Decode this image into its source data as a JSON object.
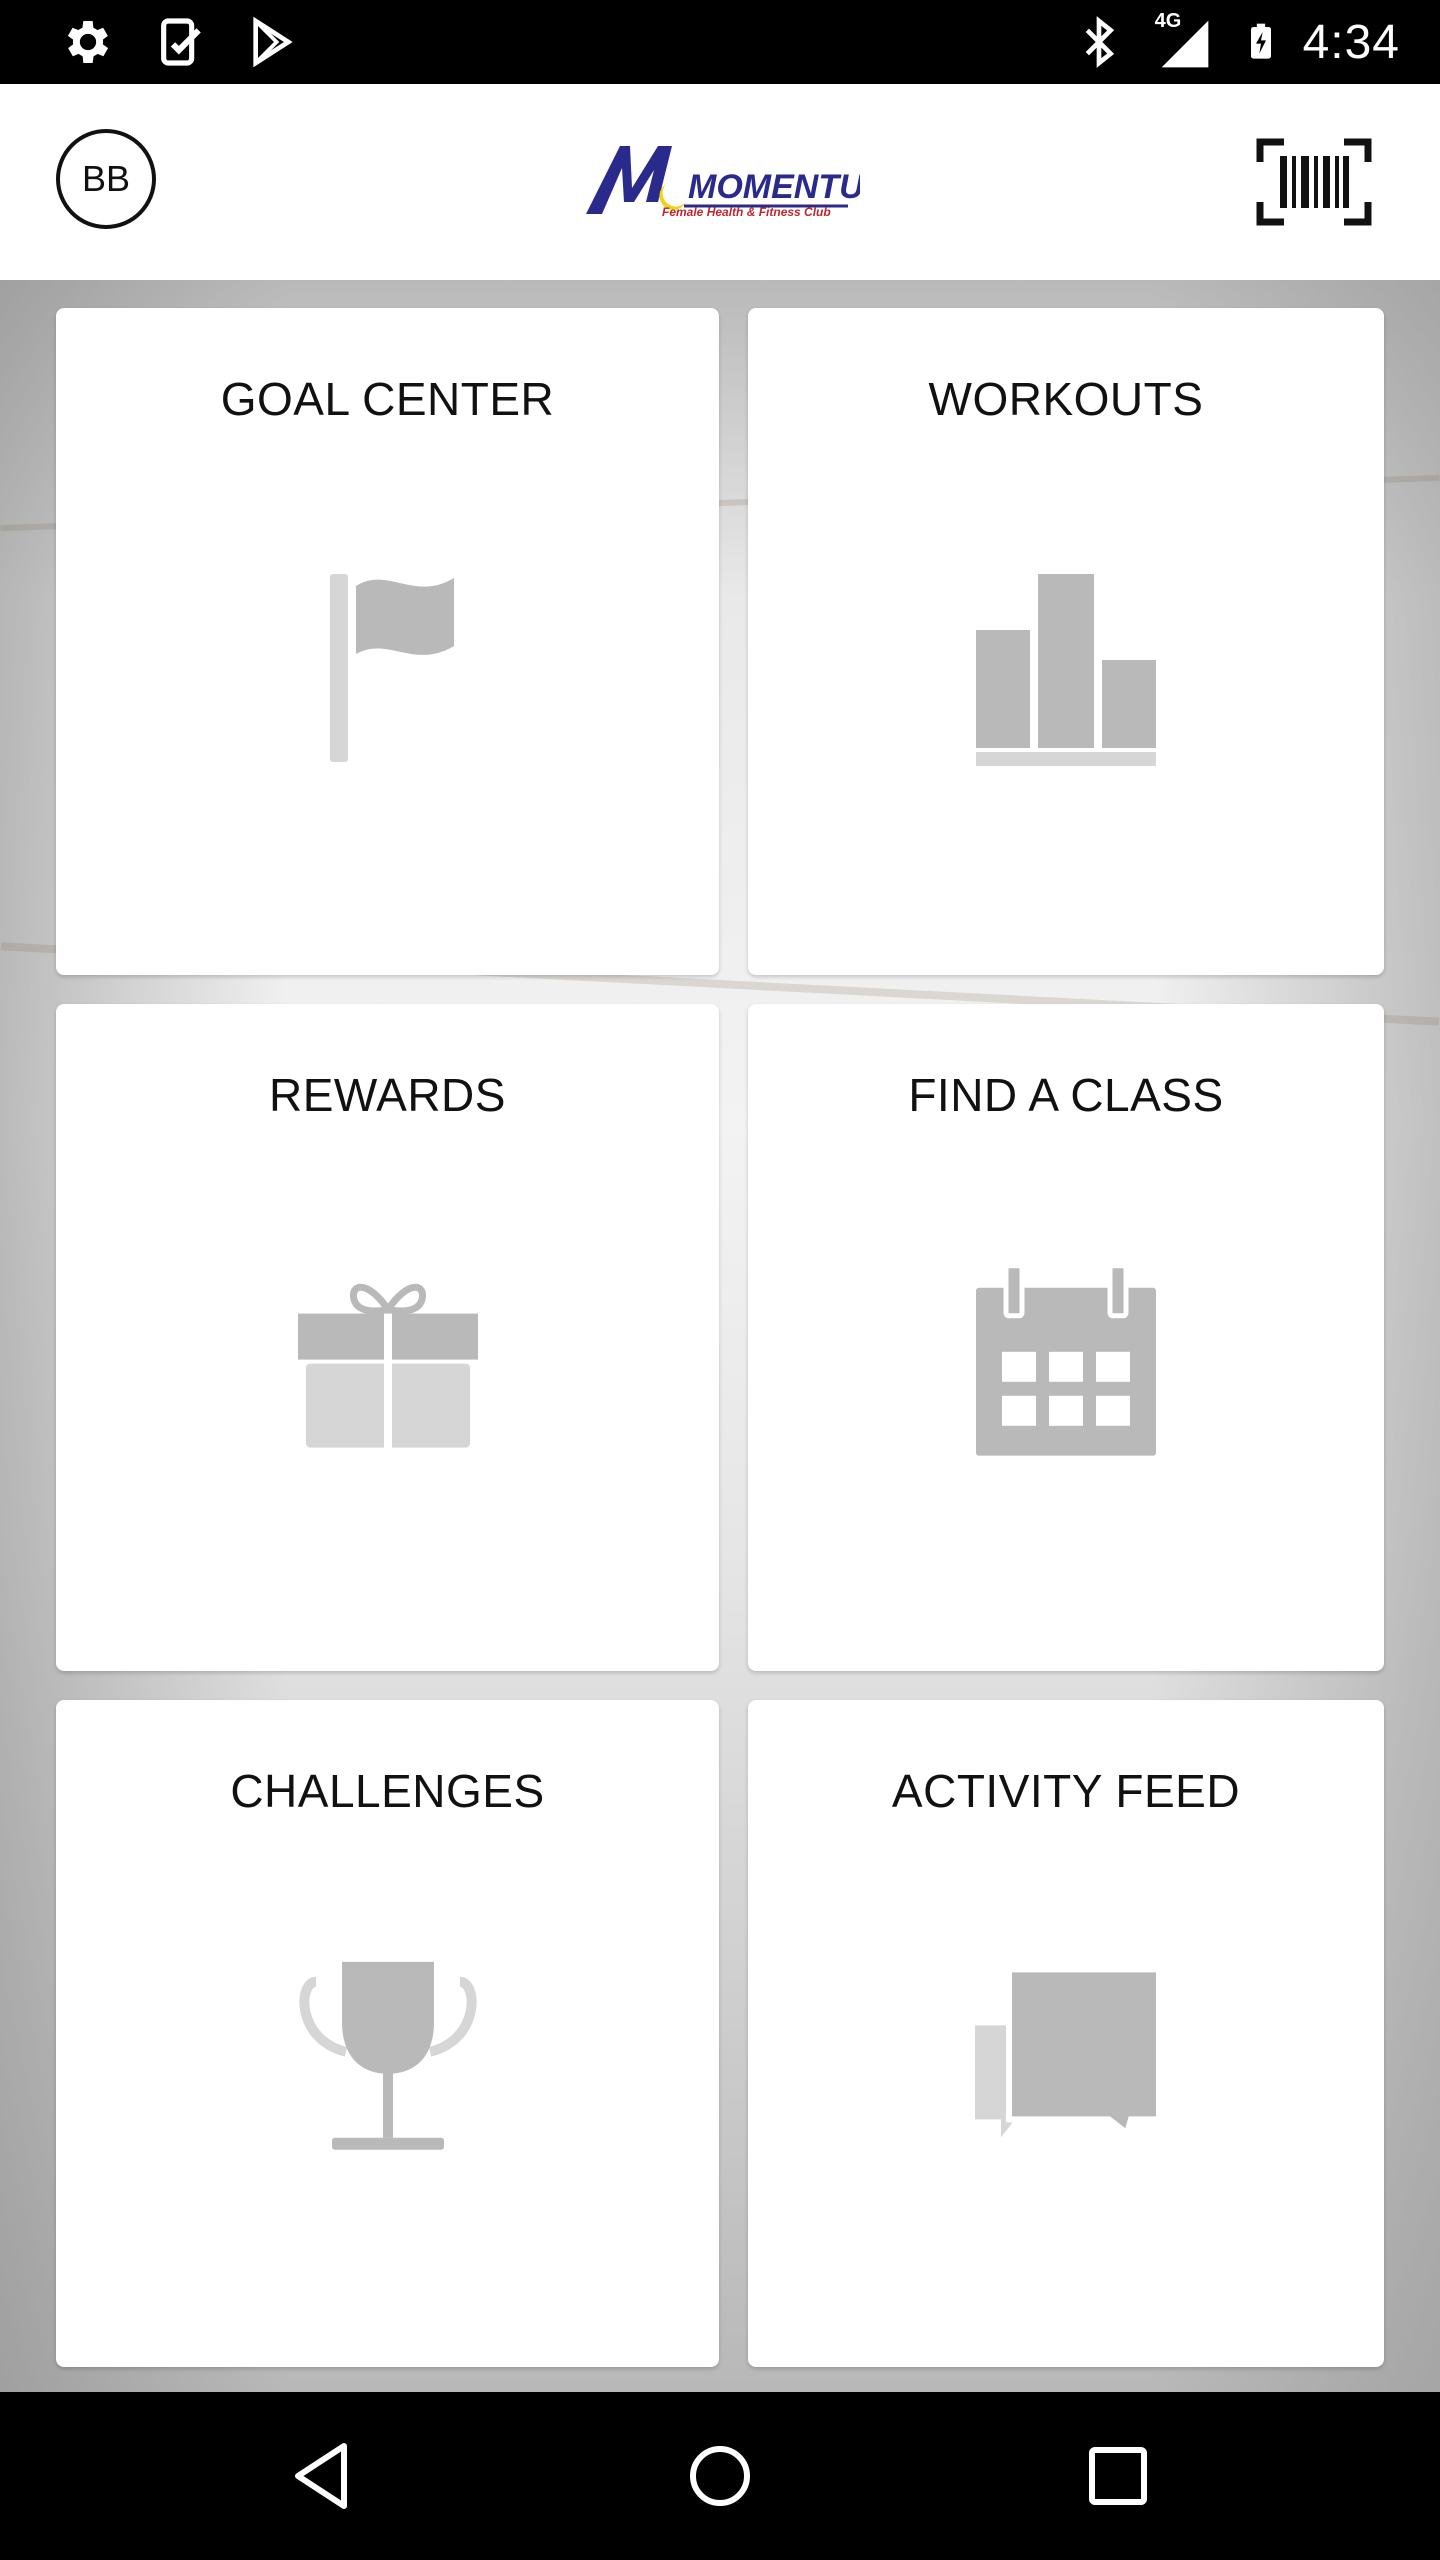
{
  "status_bar": {
    "time": "4:34",
    "network": "4G",
    "left_icons": [
      "settings-icon",
      "task-check-icon",
      "play-store-icon"
    ],
    "right_icons": [
      "bluetooth-icon",
      "signal-icon",
      "battery-charging-icon"
    ]
  },
  "app_bar": {
    "avatar_initials": "BB",
    "logo_text": "MOMENTUM",
    "logo_tagline": "Female Health & Fitness Club",
    "barcode_icon": "barcode-scan-icon"
  },
  "tiles": [
    {
      "title": "GOAL CENTER",
      "icon": "flag-icon"
    },
    {
      "title": "WORKOUTS",
      "icon": "bar-chart-icon"
    },
    {
      "title": "REWARDS",
      "icon": "gift-icon"
    },
    {
      "title": "FIND A CLASS",
      "icon": "calendar-icon"
    },
    {
      "title": "CHALLENGES",
      "icon": "trophy-icon"
    },
    {
      "title": "ACTIVITY FEED",
      "icon": "chat-bubbles-icon"
    }
  ],
  "nav_bar": {
    "buttons": [
      "back-icon",
      "home-icon",
      "recents-icon"
    ]
  },
  "colors": {
    "icon_gray": "#b9b9b9",
    "icon_light_gray": "#d6d6d6",
    "logo_blue": "#2a2a8c",
    "logo_yellow": "#f1d21b",
    "logo_red": "#c0272d"
  }
}
